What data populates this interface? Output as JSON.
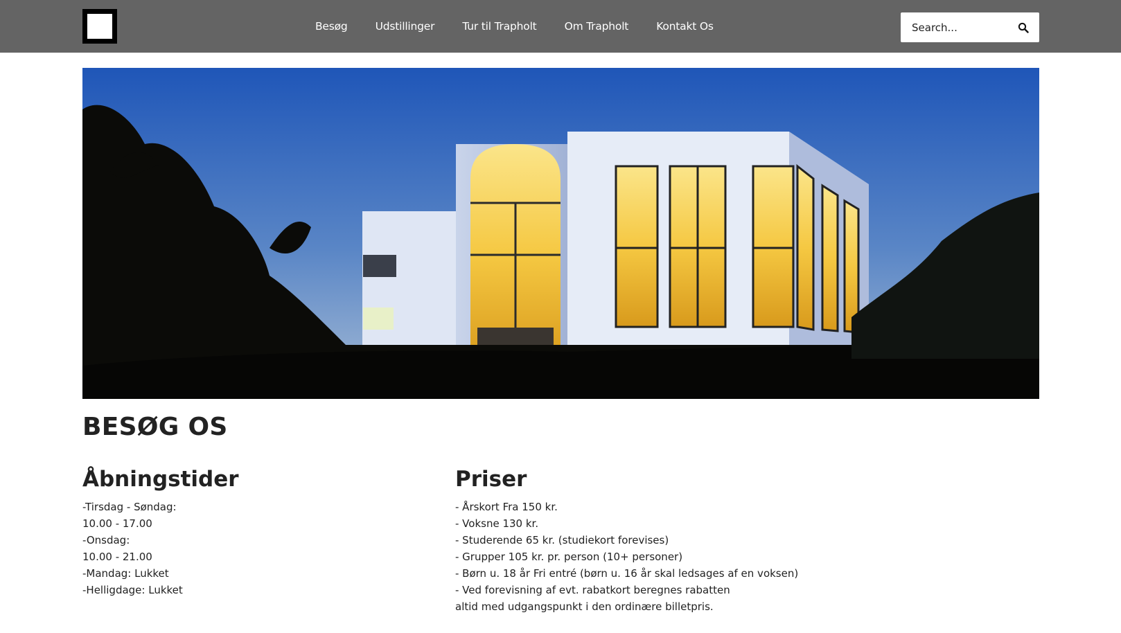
{
  "header": {
    "nav": [
      {
        "label": "Besøg"
      },
      {
        "label": "Udstillinger"
      },
      {
        "label": "Tur til Trapholt"
      },
      {
        "label": "Om Trapholt"
      },
      {
        "label": "Kontakt Os"
      }
    ],
    "search": {
      "placeholder": "Search...",
      "icon": "search-icon"
    },
    "logo_icon": "square-logo-icon"
  },
  "hero": {
    "alt": "Trapholt museum building at dusk with illuminated windows"
  },
  "main": {
    "title": "BESØG OS",
    "hours": {
      "heading": "Åbningstider",
      "lines": [
        "-Tirsdag - Søndag:",
        "10.00 - 17.00",
        "-Onsdag:",
        "10.00 - 21.00",
        "-Mandag: Lukket",
        "-Helligdage: Lukket"
      ]
    },
    "prices": {
      "heading": "Priser",
      "lines": [
        "- Årskort Fra 150 kr.",
        "- Voksne 130 kr.",
        "- Studerende 65 kr. (studiekort forevises)",
        "- Grupper 105 kr. pr. person (10+ personer)",
        "- Børn u. 18 år Fri entré (børn u. 16 år skal ledsages af en voksen)",
        "- Ved forevisning af evt. rabatkort beregnes rabatten",
        "altid med udgangspunkt i den ordinære billetpris."
      ]
    }
  },
  "colors": {
    "header_bg": "#646464",
    "text": "#222222",
    "sky_top": "#1f56b8",
    "sky_bottom": "#9fb8d6",
    "window_glow": "#f5c842"
  }
}
